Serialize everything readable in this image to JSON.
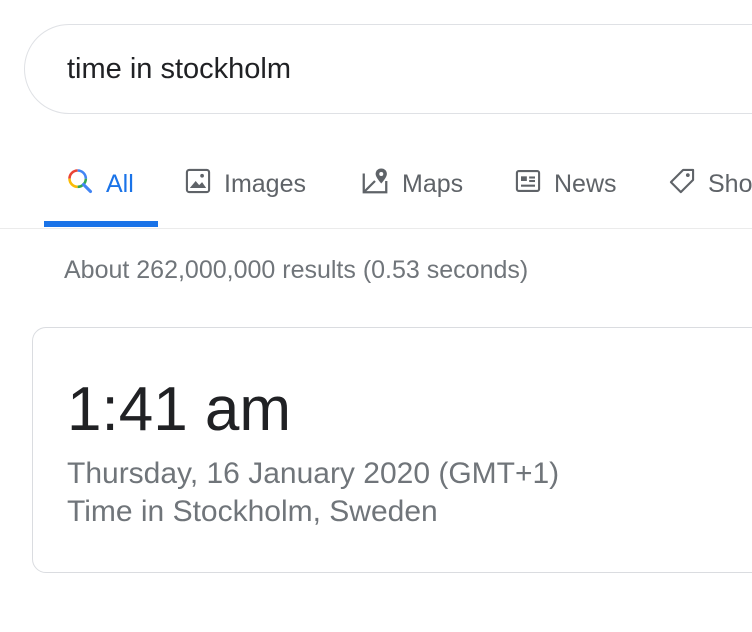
{
  "search": {
    "query": "time in stockholm"
  },
  "tabs": [
    {
      "label": "All",
      "icon": "search-icon",
      "active": true
    },
    {
      "label": "Images",
      "icon": "image-icon",
      "active": false
    },
    {
      "label": "Maps",
      "icon": "map-icon",
      "active": false
    },
    {
      "label": "News",
      "icon": "news-icon",
      "active": false
    },
    {
      "label": "Sho",
      "icon": "tag-icon",
      "active": false
    }
  ],
  "colors": {
    "accent": "#1a73e8",
    "text_primary": "#202124",
    "text_secondary": "#70757a",
    "border": "#dadce0"
  },
  "result_stats": "About 262,000,000 results (0.53 seconds)",
  "time_card": {
    "time": "1:41 am",
    "date": "Thursday, 16 January 2020 (GMT+1)",
    "location": "Time in Stockholm, Sweden"
  }
}
